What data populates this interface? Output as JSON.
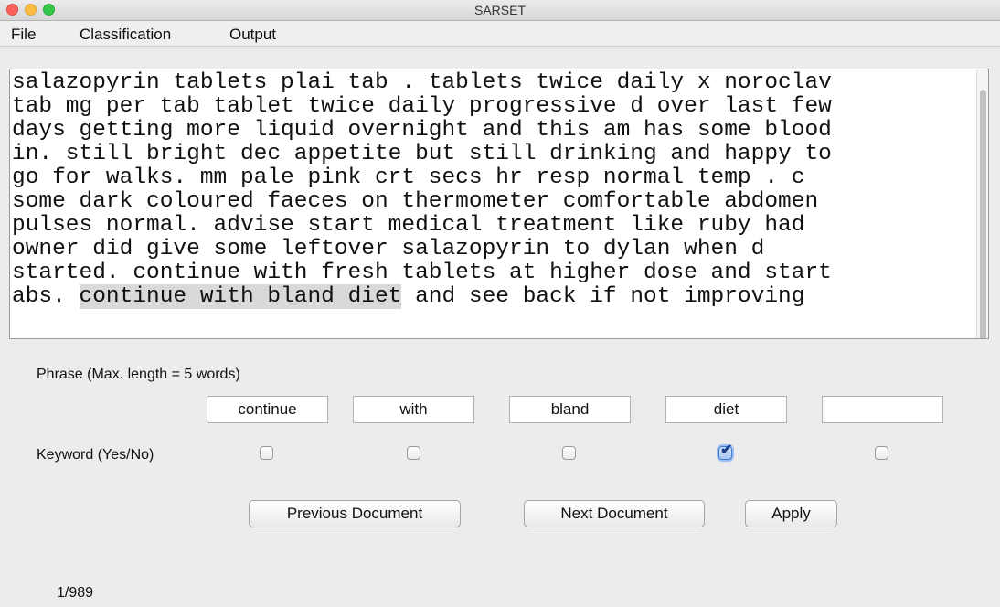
{
  "window": {
    "title": "SARSET"
  },
  "menu": {
    "items": [
      "File",
      "Classification",
      "Output"
    ]
  },
  "document": {
    "lines": [
      "salazopyrin tablets plai tab . tablets twice daily x noroclav",
      "tab mg per tab tablet twice daily progressive d over last few",
      "days getting more liquid overnight and this am has some blood",
      "in. still bright dec appetite but still drinking and happy to",
      "go for walks. mm pale pink crt secs hr resp normal temp . c",
      "some dark coloured faeces on thermometer comfortable abdomen",
      "pulses normal. advise start medical treatment like ruby had",
      "owner did give some leftover salazopyrin to dylan when d",
      "started. continue with fresh tablets at higher dose and start"
    ],
    "last_line_prefix": "abs. ",
    "highlighted_phrase": "continue with bland diet",
    "last_line_suffix": " and see back if not improving"
  },
  "phrase": {
    "label": "Phrase (Max. length = 5 words)",
    "words": [
      "continue",
      "with",
      "bland",
      "diet",
      ""
    ]
  },
  "keyword": {
    "label": "Keyword (Yes/No)",
    "checked": [
      false,
      false,
      false,
      true,
      false
    ]
  },
  "buttons": {
    "previous": "Previous Document",
    "next": "Next Document",
    "apply": "Apply"
  },
  "status": {
    "counter": "1/989"
  }
}
